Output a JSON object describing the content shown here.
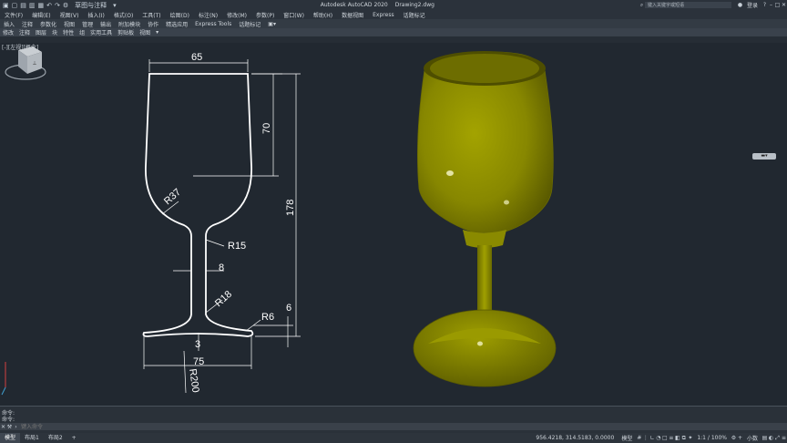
{
  "titlebar": {
    "workspace": "草图与注释",
    "app_title": "Autodesk AutoCAD 2020",
    "file_name": "Drawing2.dwg",
    "search_placeholder": "键入关键字或短语",
    "sign_in": "登录"
  },
  "menubar": [
    "文件(F)",
    "编辑(E)",
    "视图(V)",
    "插入(I)",
    "格式(O)",
    "工具(T)",
    "绘图(D)",
    "标注(N)",
    "修改(M)",
    "参数(P)",
    "窗口(W)",
    "帮助(H)",
    "数据视图",
    "Express",
    "话题标记"
  ],
  "ribbon_tabs": [
    "插入",
    "注释",
    "参数化",
    "视图",
    "管理",
    "输出",
    "附加模块",
    "协作",
    "精选应用",
    "Express Tools",
    "话题标记"
  ],
  "ribbon_panels": [
    "修改",
    "注释",
    "图层",
    "块",
    "特性",
    "组",
    "实用工具",
    "剪贴板",
    "视图"
  ],
  "viewport_label": "[-][左视][概念]",
  "drawing": {
    "dims": {
      "top_width": "65",
      "bowl_height": "70",
      "total_height": "178",
      "bowl_radius": "R37",
      "neck_radius": "R15",
      "stem_width": "8",
      "stem_radius": "R18",
      "base_radius": "R6",
      "base_height": "6",
      "base_thickness": "3",
      "base_width": "75",
      "base_curve": "R200"
    }
  },
  "colors": {
    "background": "#212830",
    "line": "#ffffff",
    "glass": "#8f8f00"
  },
  "command": {
    "history1": "命令:",
    "history2": "命令:",
    "placeholder": "键入命令"
  },
  "statusbar": {
    "tabs": [
      "模型",
      "布局1",
      "布局2"
    ],
    "coords": "956.4218, 314.5183, 0.0000",
    "mode": "模型",
    "scale": "1:1 / 100%",
    "units": "小数"
  }
}
